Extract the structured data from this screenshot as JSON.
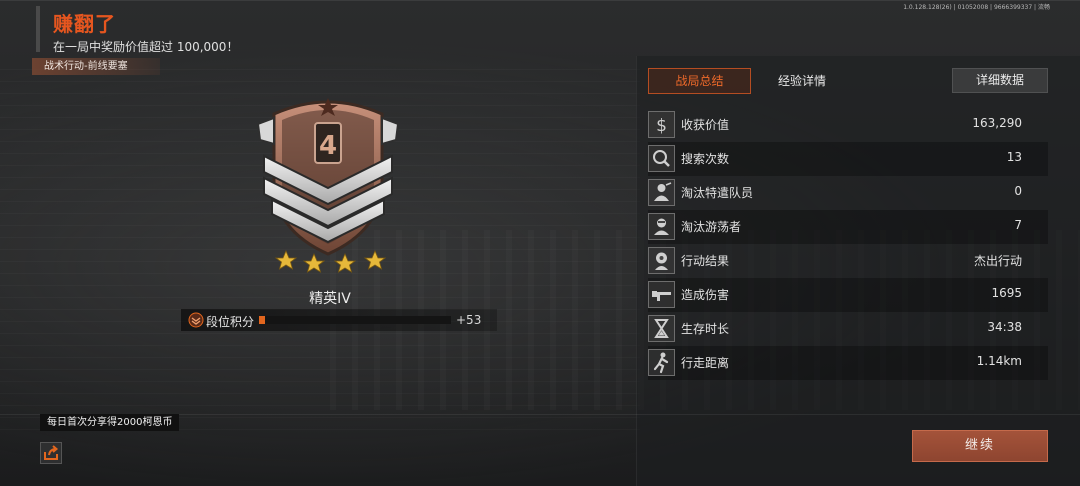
{
  "version_text": "1.0.128.128(26) | 01052008 | 9666399337 | 流畅",
  "header": {
    "title": "赚翻了",
    "subtitle": "在一局中奖励价值超过 100,000！",
    "mode_tag": "战术行动-前线要塞"
  },
  "rank": {
    "level_number": "4",
    "stars": 4,
    "name": "精英IV",
    "points_label": "段位积分",
    "points_progress_fraction": 0.03,
    "points_delta": "+53"
  },
  "tabs": {
    "active": "战局总结",
    "second": "经验详情",
    "detail_button": "详细数据"
  },
  "stats": [
    {
      "icon": "dollar-icon",
      "label": "收获价值",
      "value": "163,290"
    },
    {
      "icon": "search-icon",
      "label": "搜索次数",
      "value": "13"
    },
    {
      "icon": "operator-icon",
      "label": "淘汰特遣队员",
      "value": "0"
    },
    {
      "icon": "wanderer-icon",
      "label": "淘汰游荡者",
      "value": "7"
    },
    {
      "icon": "result-icon",
      "label": "行动结果",
      "value": "杰出行动"
    },
    {
      "icon": "rifle-icon",
      "label": "造成伤害",
      "value": "1695"
    },
    {
      "icon": "hourglass-icon",
      "label": "生存时长",
      "value": "34:38"
    },
    {
      "icon": "running-icon",
      "label": "行走距离",
      "value": "1.14km"
    }
  ],
  "bottom": {
    "share_tip": "每日首次分享得2000柯恩币",
    "share_icon": "share-icon",
    "continue_label": "继续"
  },
  "colors": {
    "accent_orange": "#e6561f",
    "continue_button": "#9a4d35",
    "emblem_bronze": "#a8705a"
  }
}
